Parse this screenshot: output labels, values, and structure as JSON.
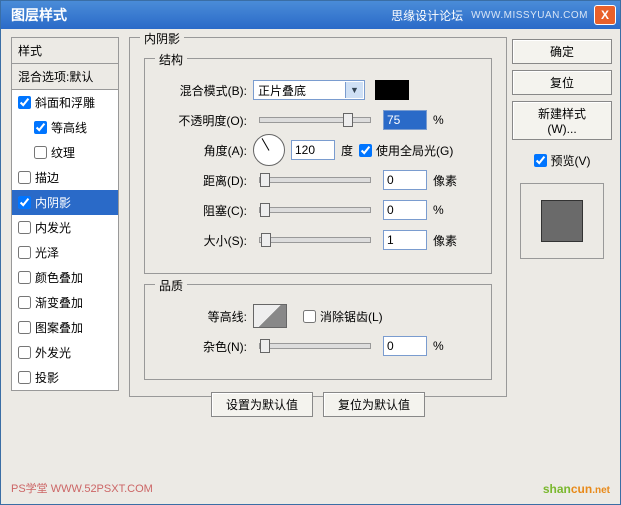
{
  "window": {
    "title": "图层样式",
    "forum": "思缘设计论坛",
    "url": "WWW.MISSYUAN.COM",
    "close": "X"
  },
  "sidebar": {
    "header_styles": "样式",
    "header_blend": "混合选项:默认",
    "items": [
      {
        "label": "斜面和浮雕",
        "checked": true,
        "selected": false,
        "indent": false
      },
      {
        "label": "等高线",
        "checked": true,
        "selected": false,
        "indent": true
      },
      {
        "label": "纹理",
        "checked": false,
        "selected": false,
        "indent": true
      },
      {
        "label": "描边",
        "checked": false,
        "selected": false,
        "indent": false
      },
      {
        "label": "内阴影",
        "checked": true,
        "selected": true,
        "indent": false
      },
      {
        "label": "内发光",
        "checked": false,
        "selected": false,
        "indent": false
      },
      {
        "label": "光泽",
        "checked": false,
        "selected": false,
        "indent": false
      },
      {
        "label": "颜色叠加",
        "checked": false,
        "selected": false,
        "indent": false
      },
      {
        "label": "渐变叠加",
        "checked": false,
        "selected": false,
        "indent": false
      },
      {
        "label": "图案叠加",
        "checked": false,
        "selected": false,
        "indent": false
      },
      {
        "label": "外发光",
        "checked": false,
        "selected": false,
        "indent": false
      },
      {
        "label": "投影",
        "checked": false,
        "selected": false,
        "indent": false
      }
    ]
  },
  "panel": {
    "title": "内阴影",
    "structure": {
      "legend": "结构",
      "blend_mode_label": "混合模式(B):",
      "blend_mode_value": "正片叠底",
      "color": "#000000",
      "opacity_label": "不透明度(O):",
      "opacity_value": "75",
      "opacity_unit": "%",
      "angle_label": "角度(A):",
      "angle_value": "120",
      "angle_unit": "度",
      "global_light_label": "使用全局光(G)",
      "global_light_checked": true,
      "distance_label": "距离(D):",
      "distance_value": "0",
      "distance_unit": "像素",
      "choke_label": "阻塞(C):",
      "choke_value": "0",
      "choke_unit": "%",
      "size_label": "大小(S):",
      "size_value": "1",
      "size_unit": "像素"
    },
    "quality": {
      "legend": "品质",
      "contour_label": "等高线:",
      "antialias_label": "消除锯齿(L)",
      "antialias_checked": false,
      "noise_label": "杂色(N):",
      "noise_value": "0",
      "noise_unit": "%"
    },
    "buttons": {
      "set_default": "设置为默认值",
      "reset_default": "复位为默认值"
    }
  },
  "right": {
    "ok": "确定",
    "reset": "复位",
    "new_style": "新建样式(W)...",
    "preview_label": "预览(V)",
    "preview_checked": true
  },
  "footer": {
    "left": "PS学堂  WWW.52PSXT.COM",
    "right_1": "shan",
    "right_2": "cun",
    "right_3": ".net"
  }
}
